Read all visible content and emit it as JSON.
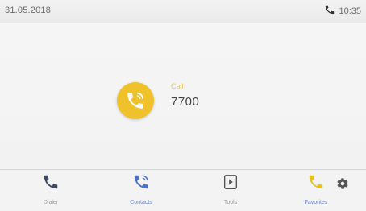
{
  "status_bar": {
    "date": "31.05.2018",
    "time": "10:35",
    "icon": "phone-icon"
  },
  "call": {
    "icon": "call-in-progress-icon",
    "state": "Call",
    "number": "7700",
    "accent_color": "#efc22b"
  },
  "nav": {
    "items": [
      {
        "icon": "phone-icon",
        "label": "Dialer",
        "color": "#3a4a66"
      },
      {
        "icon": "contacts-phone-icon",
        "label": "Contacts",
        "color": "#4a6fc6",
        "active": true
      },
      {
        "icon": "transfer-icon",
        "label": "Tools",
        "color": "#555555"
      },
      {
        "icon": "phone-icon",
        "label": "Favorites",
        "color": "#e8c020",
        "active": true
      }
    ],
    "settings_icon": "gear-icon"
  }
}
